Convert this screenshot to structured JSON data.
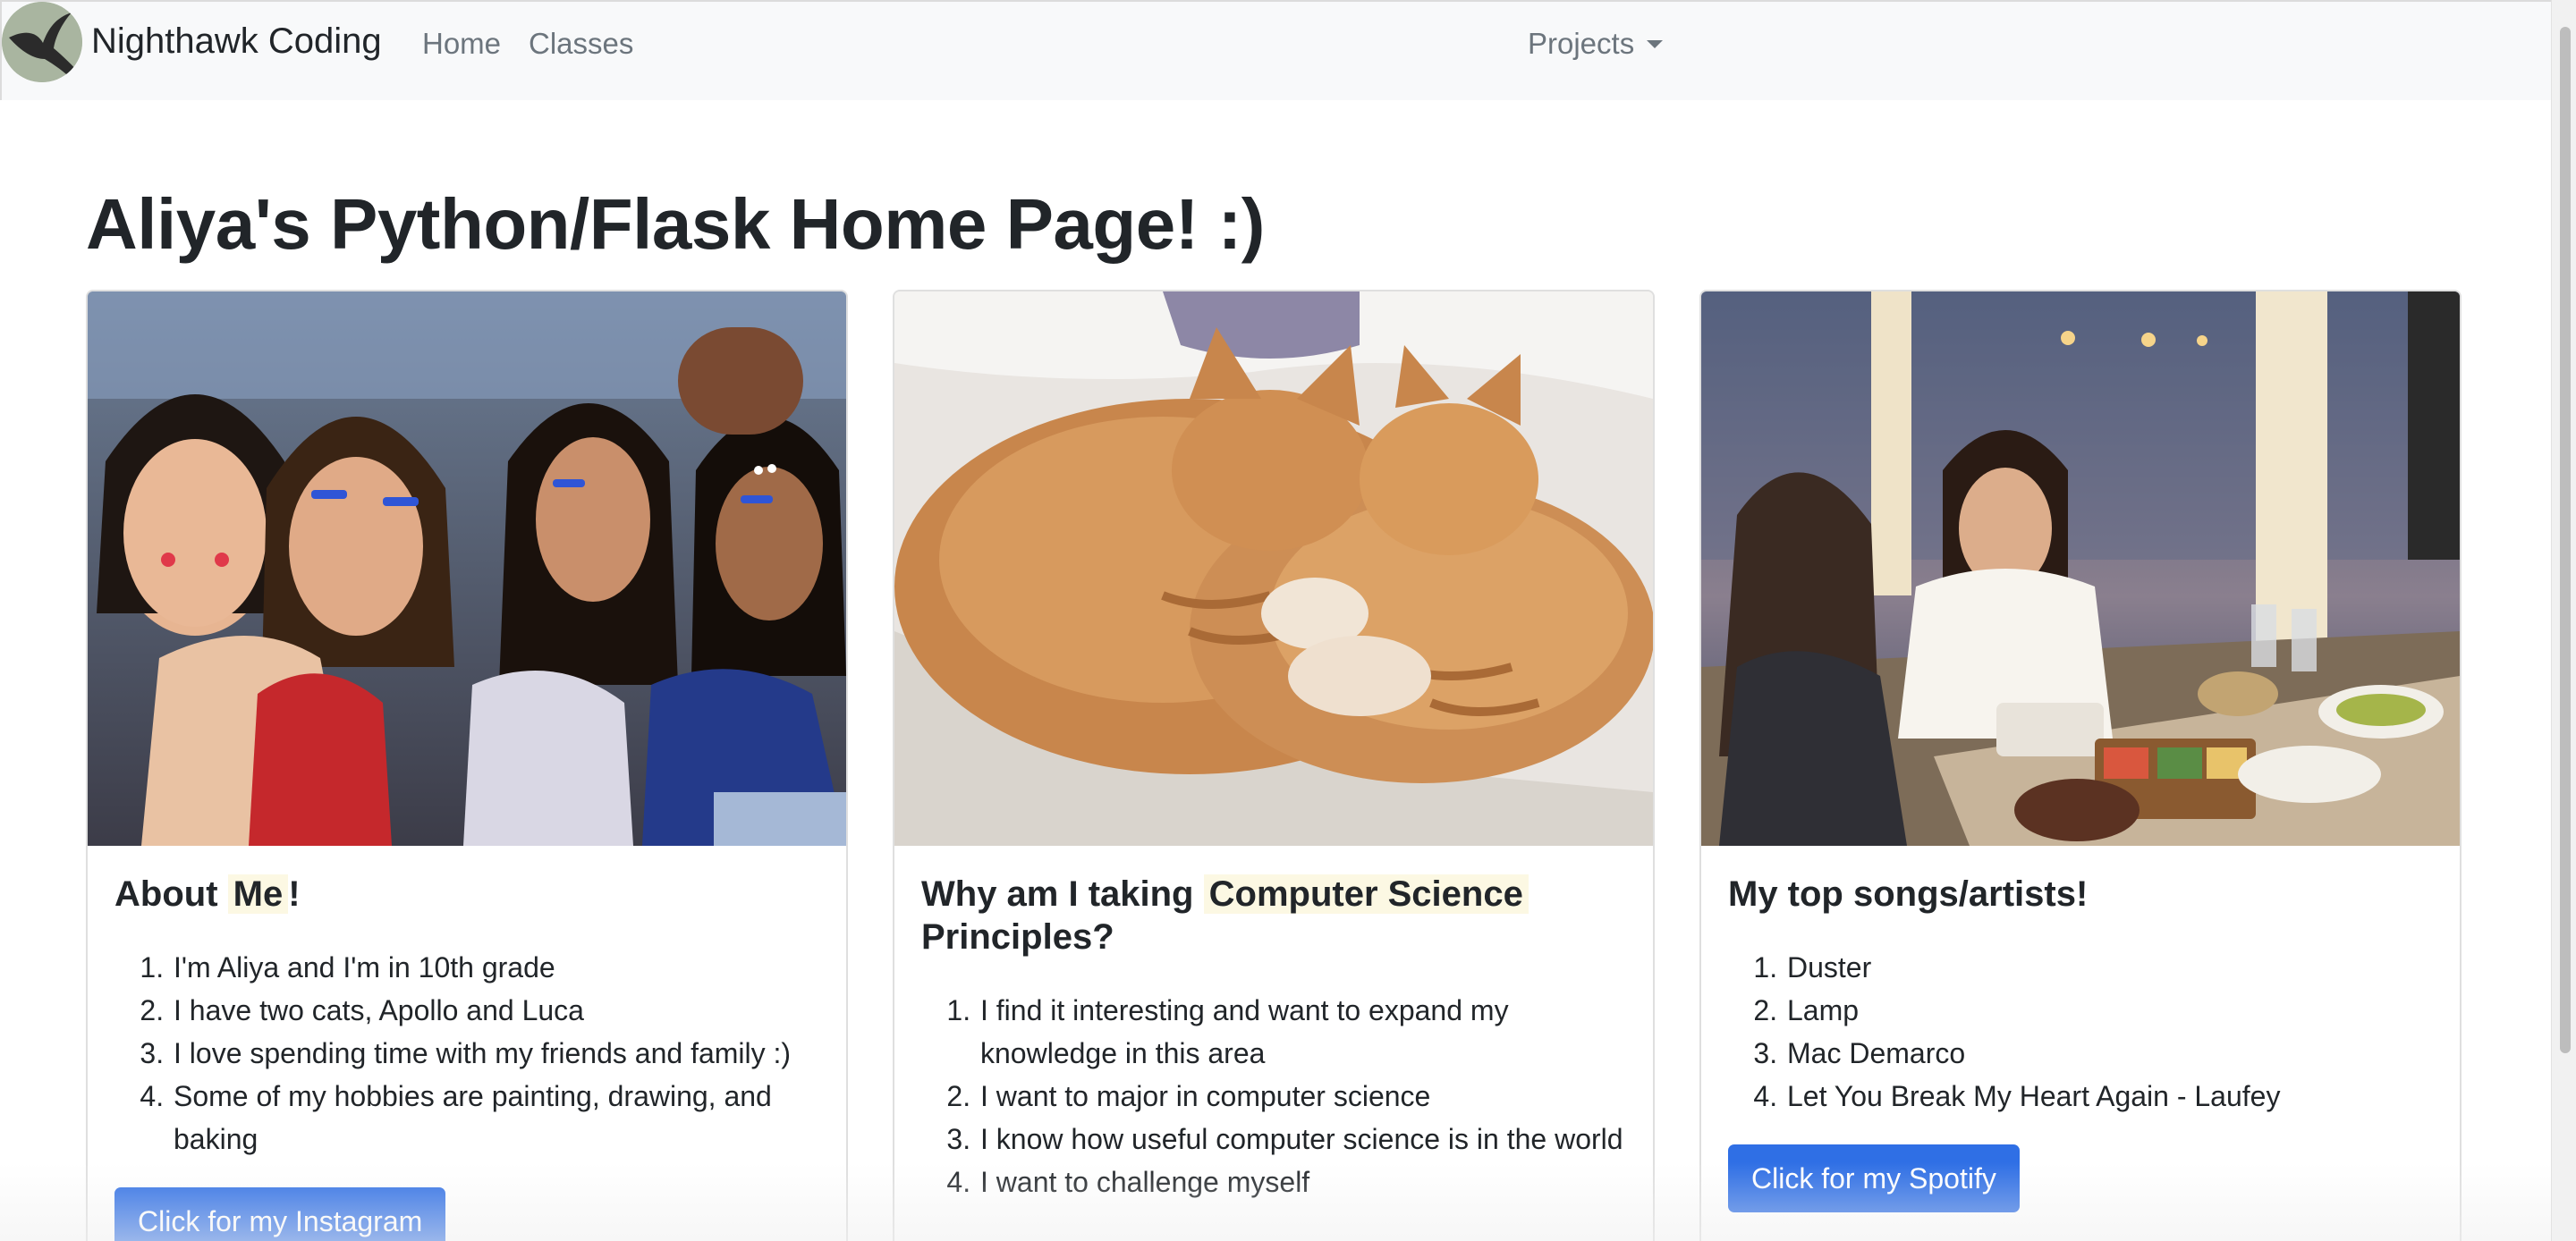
{
  "navbar": {
    "brand": "Nighthawk Coding",
    "links": [
      "Home",
      "Classes"
    ],
    "dropdown": "Projects"
  },
  "page": {
    "title": "Aliya's Python/Flask Home Page! :)"
  },
  "cards": [
    {
      "title_prefix": "About",
      "title_highlight": "Me",
      "title_suffix": "!",
      "items": [
        "I'm Aliya and I'm in 10th grade",
        "I have two cats, Apollo and Luca",
        "I love spending time with my friends and family :)",
        "Some of my hobbies are painting, drawing, and baking"
      ],
      "button": "Click for my Instagram"
    },
    {
      "title_prefix": "Why am I taking",
      "title_highlight": "Computer Science",
      "title_suffix": "Principles?",
      "items": [
        "I find it interesting and want to expand my knowledge in this area",
        "I want to major in computer science",
        "I know how useful computer science is in the world",
        "I want to challenge myself"
      ]
    },
    {
      "title": "My top songs/artists!",
      "items": [
        "Duster",
        "Lamp",
        "Mac Demarco",
        "Let You Break My Heart Again - Laufey"
      ],
      "button": "Click for my Spotify"
    }
  ],
  "colors": {
    "navbar_bg": "#f8f9fa",
    "button_bg": "#2f6fe5",
    "highlight_bg": "#fcf8e3"
  }
}
